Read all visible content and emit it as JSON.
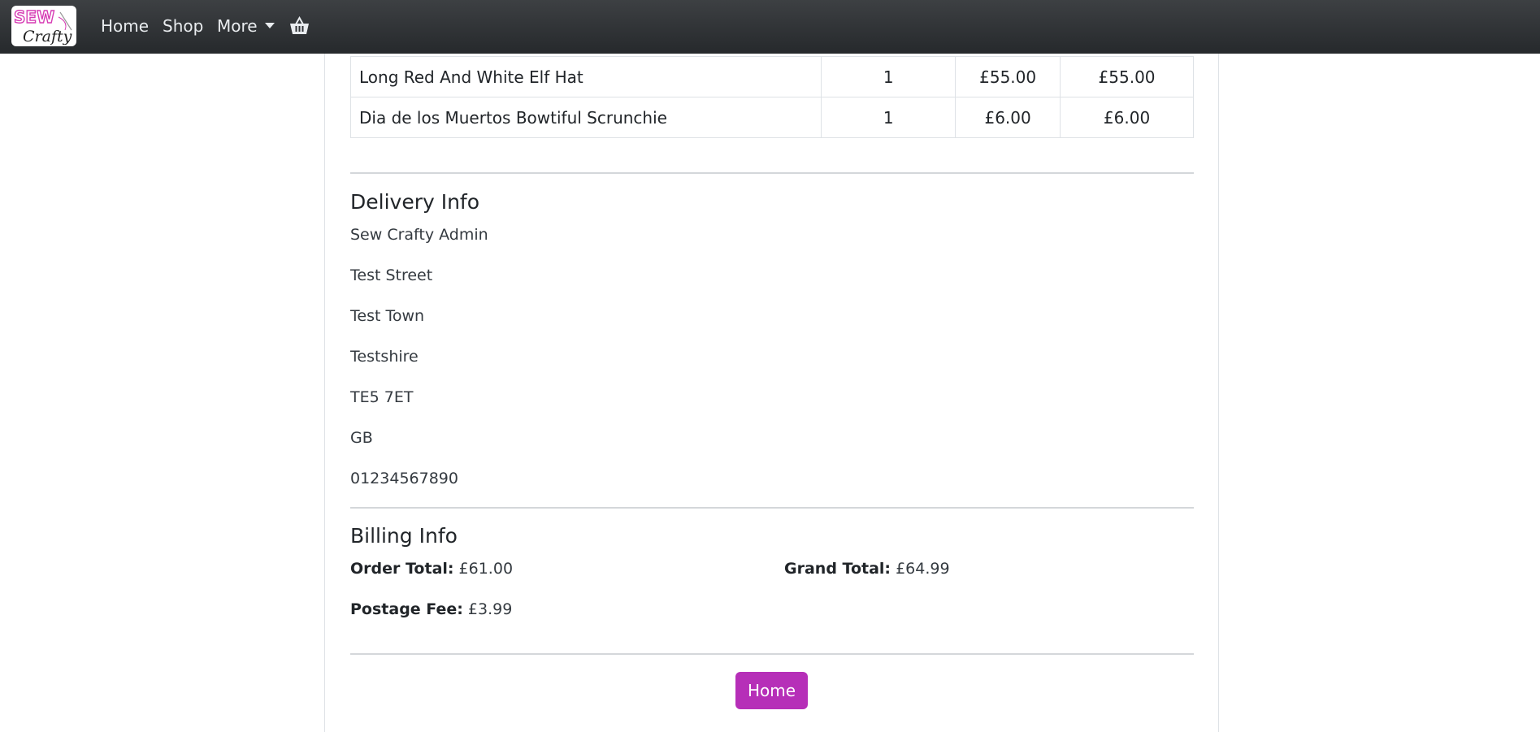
{
  "nav": {
    "logo_top": "SEW",
    "logo_bottom": "Crafty",
    "home": "Home",
    "shop": "Shop",
    "more": "More"
  },
  "order_items": [
    {
      "name": "Long Red And White Elf Hat",
      "qty": "1",
      "price": "£55.00",
      "total": "£55.00"
    },
    {
      "name": "Dia de los Muertos Bowtiful Scrunchie",
      "qty": "1",
      "price": "£6.00",
      "total": "£6.00"
    }
  ],
  "delivery": {
    "heading": "Delivery Info",
    "name": "Sew Crafty Admin",
    "street": "Test Street",
    "town": "Test Town",
    "county": "Testshire",
    "postcode": "TE5 7ET",
    "country": "GB",
    "phone": "01234567890"
  },
  "billing": {
    "heading": "Billing Info",
    "order_total_label": "Order Total:",
    "order_total": "£61.00",
    "grand_total_label": "Grand Total:",
    "grand_total": "£64.99",
    "postage_label": "Postage Fee:",
    "postage": "£3.99"
  },
  "footer": {
    "home_button": "Home"
  },
  "colors": {
    "navbar": "#343a40",
    "accent": "#b62fb8",
    "logo_pink": "#d63cb4"
  }
}
